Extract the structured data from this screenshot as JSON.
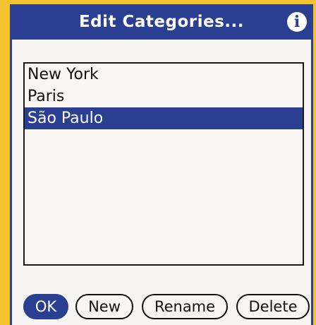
{
  "dialog": {
    "title": "Edit Categories...",
    "info_icon": "i"
  },
  "categories": {
    "items": [
      {
        "label": "New York",
        "selected": false
      },
      {
        "label": "Paris",
        "selected": false
      },
      {
        "label": "São Paulo",
        "selected": true
      }
    ]
  },
  "buttons": {
    "ok": "OK",
    "new": "New",
    "rename": "Rename",
    "delete": "Delete"
  },
  "colors": {
    "accent": "#2b3f92",
    "frame": "#f3c32f",
    "background": "#f7f5f1"
  }
}
